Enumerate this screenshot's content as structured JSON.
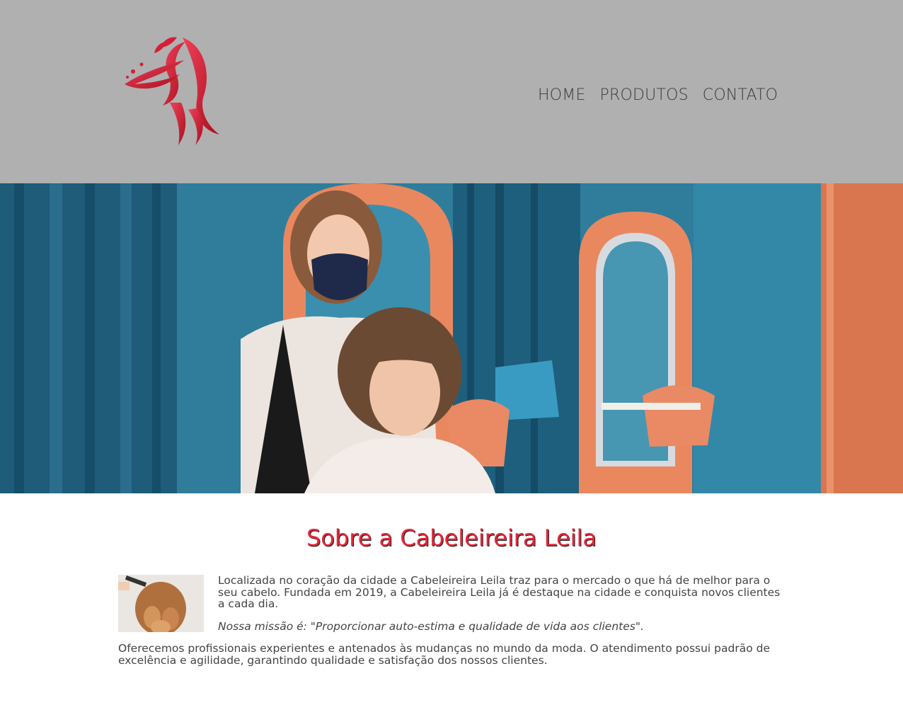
{
  "header": {
    "logo_icon": "woman-hair-profile-logo",
    "brand_color": "#d51f36",
    "background": "#b0b0b0",
    "nav": [
      {
        "label": "HOME"
      },
      {
        "label": "PRODUTOS"
      },
      {
        "label": "CONTATO"
      }
    ]
  },
  "hero": {
    "image": "hairdresser-salon-photo",
    "background": "#2d7a98",
    "accent": "#e9885f"
  },
  "about": {
    "title": "Sobre a Cabeleireira Leila",
    "title_color": "#e0283a",
    "thumbnail": "curly-hair-styling-photo",
    "paragraph1": "Localizada no coração da cidade a Cabeleireira Leila traz para o mercado o que há de melhor para o seu cabelo. Fundada em 2019, a Cabeleireira Leila já é destaque na cidade e conquista novos clientes a cada dia.",
    "mission": "Nossa missão é: \"Proporcionar auto-estima e qualidade de vida aos clientes\".",
    "paragraph3": "Oferecemos profissionais experientes e antenados às mudanças no mundo da moda. O atendimento possui padrão de excelência e agilidade, garantindo qualidade e satisfação dos nossos clientes."
  }
}
